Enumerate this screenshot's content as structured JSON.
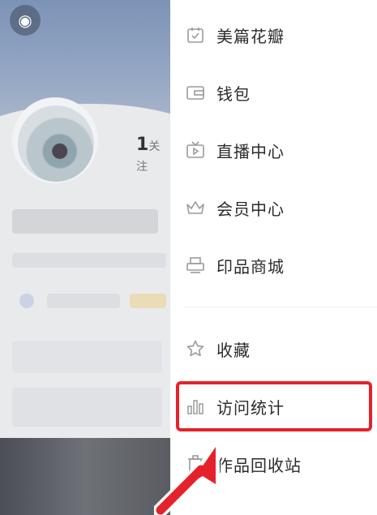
{
  "menu": {
    "items": [
      {
        "label": "美篇花瓣",
        "icon": "calendar-check-icon"
      },
      {
        "label": "钱包",
        "icon": "wallet-icon"
      },
      {
        "label": "直播中心",
        "icon": "live-tv-icon"
      },
      {
        "label": "会员中心",
        "icon": "crown-icon"
      },
      {
        "label": "印品商城",
        "icon": "printer-icon"
      },
      {
        "label": "收藏",
        "icon": "star-icon"
      },
      {
        "label": "访问统计",
        "icon": "bar-chart-icon"
      },
      {
        "label": "作品回收站",
        "icon": "trash-icon"
      }
    ]
  },
  "profile": {
    "follow_count": "1",
    "follow_label": "关注"
  },
  "colors": {
    "highlight": "#e5222a",
    "icon_stroke": "#9a9a9a",
    "text": "#2b2b2b"
  }
}
